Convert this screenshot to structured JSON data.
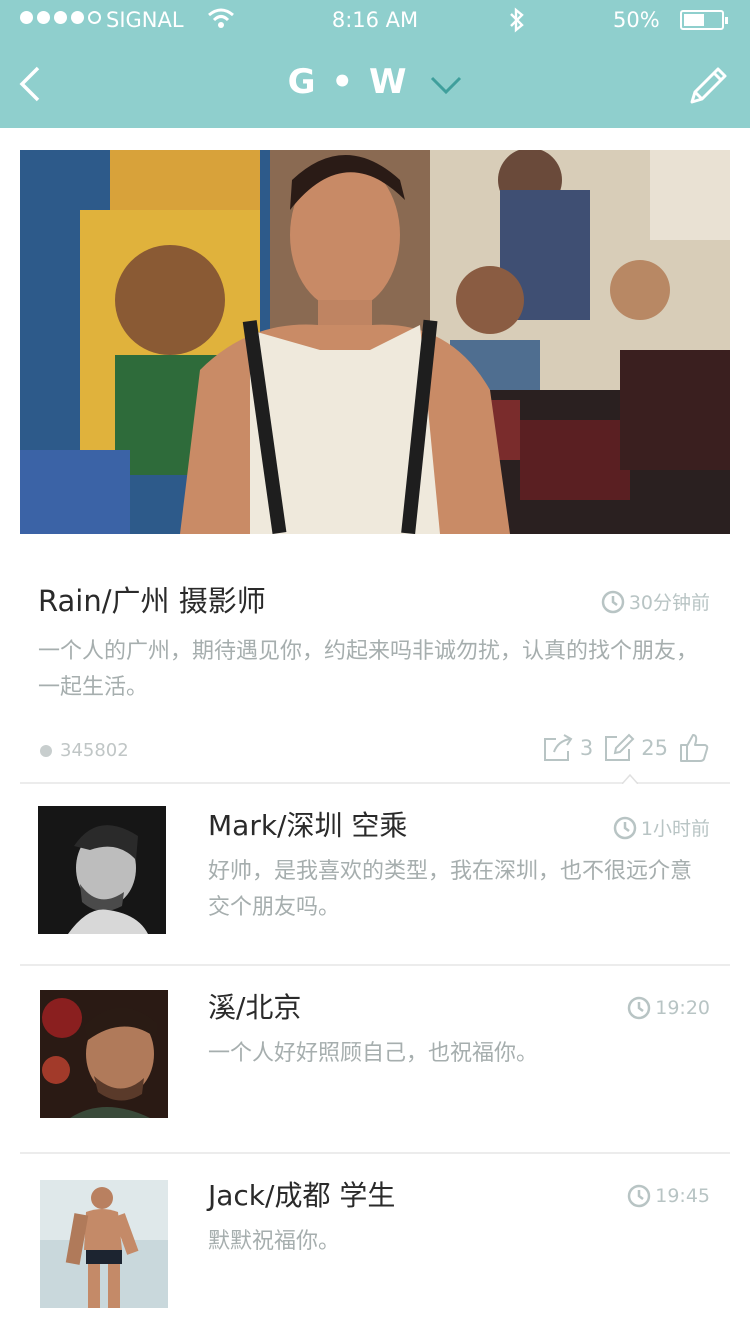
{
  "status_bar": {
    "carrier": "SIGNAL",
    "time": "8:16 AM",
    "battery": "50%",
    "signal_bars_filled": 4,
    "signal_bars_total": 5,
    "battery_level_fraction": 0.5
  },
  "nav": {
    "title": "G • W",
    "icons": {
      "back": "chevron-left-icon",
      "dropdown": "chevron-down-icon",
      "edit": "pencil-icon"
    }
  },
  "post": {
    "author": "Rain/广州 摄影师",
    "time": "30分钟前",
    "text": "一个人的广州，期待遇见你，约起来吗非诚勿扰，认真的找个朋友，一起生活。",
    "id_number": "345802",
    "share_count": "3",
    "comment_count": "25"
  },
  "comments": [
    {
      "author": "Mark/深圳 空乘",
      "time": "1小时前",
      "text": "好帅，是我喜欢的类型，我在深圳，也不很远介意交个朋友吗。"
    },
    {
      "author": "溪/北京",
      "time": "19:20",
      "text": "一个人好好照顾自己，也祝福你。"
    },
    {
      "author": "Jack/成都 学生",
      "time": "19:45",
      "text": "默默祝福你。"
    }
  ],
  "colors": {
    "accent": "#8fcfcd",
    "muted_text": "#a6aeae",
    "meta_text": "#b8c4c4"
  }
}
